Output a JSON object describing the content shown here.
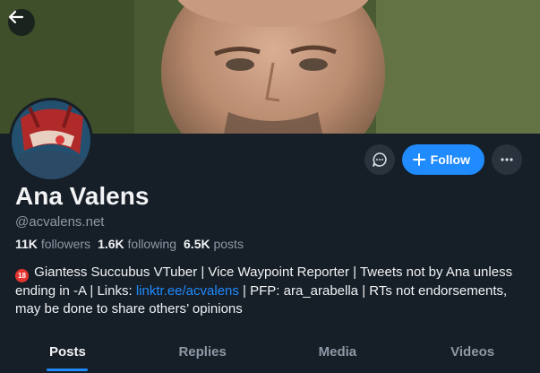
{
  "header": {
    "back_icon": "arrow-left-icon"
  },
  "profile": {
    "display_name": "Ana Valens",
    "handle": "@acvalens.net",
    "avatar": "avatar-image"
  },
  "actions": {
    "message_icon": "chat-bubble-icon",
    "follow_label": "Follow",
    "follow_icon": "plus-icon",
    "more_icon": "ellipsis-icon"
  },
  "stats": {
    "followers_count": "11K",
    "followers_label": "followers",
    "following_count": "1.6K",
    "following_label": "following",
    "posts_count": "6.5K",
    "posts_label": "posts"
  },
  "bio": {
    "emoji": "18",
    "part1": " Giantess Succubus VTuber | Vice Waypoint Reporter | Tweets not by Ana unless ending in -A | Links: ",
    "link": "linktr.ee/acvalens",
    "part2": " | PFP: ara_arabella | RTs not endorsements, may be done to share others’ opinions"
  },
  "tabs": [
    {
      "label": "Posts"
    },
    {
      "label": "Replies"
    },
    {
      "label": "Media"
    },
    {
      "label": "Videos"
    }
  ],
  "colors": {
    "background": "#161e27",
    "accent": "#208bfe",
    "muted_text": "#8d99a6"
  }
}
